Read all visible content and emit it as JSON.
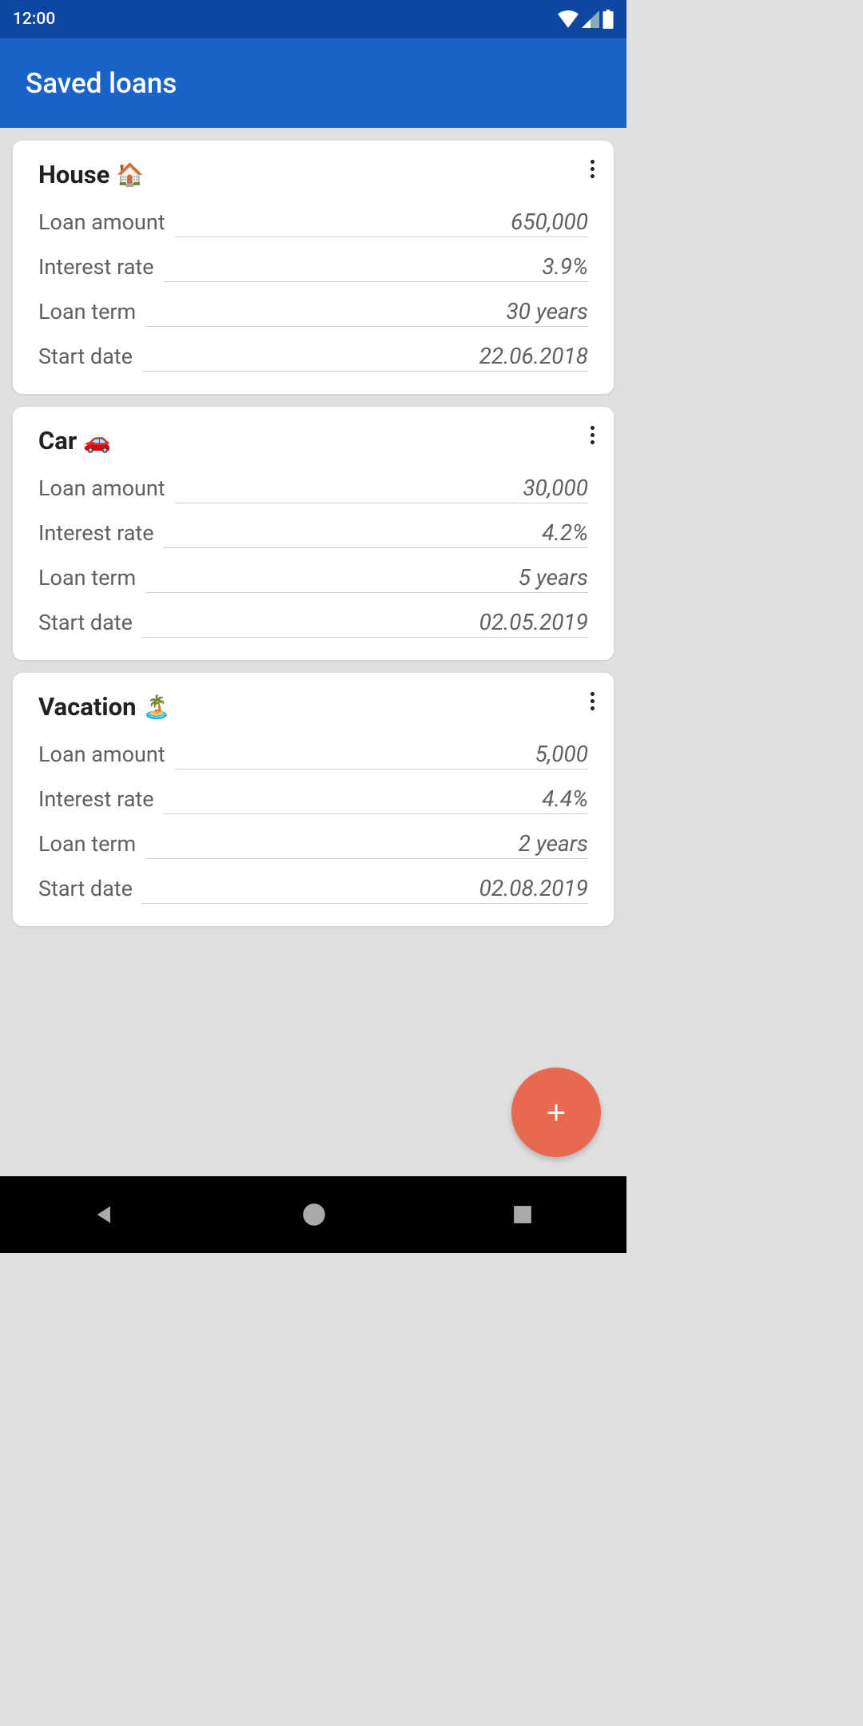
{
  "status": {
    "time": "12:00"
  },
  "header": {
    "title": "Saved loans"
  },
  "field_labels": {
    "amount": "Loan amount",
    "rate": "Interest rate",
    "term": "Loan term",
    "start": "Start date"
  },
  "loans": [
    {
      "title": "House",
      "emoji": "🏠",
      "amount": "650,000",
      "rate": "3.9%",
      "term": "30 years",
      "start": "22.06.2018"
    },
    {
      "title": "Car",
      "emoji": "🚗",
      "amount": "30,000",
      "rate": "4.2%",
      "term": "5 years",
      "start": "02.05.2019"
    },
    {
      "title": "Vacation",
      "emoji": "🏝️",
      "amount": "5,000",
      "rate": "4.4%",
      "term": "2 years",
      "start": "02.08.2019"
    }
  ],
  "fab": {
    "icon": "+"
  }
}
